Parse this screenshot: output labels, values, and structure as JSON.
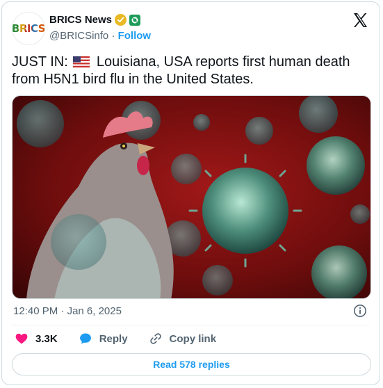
{
  "author": {
    "display_name": "BRICS News",
    "handle": "@BRICSinfo",
    "separator": "·",
    "follow_label": "Follow",
    "avatar_text": "BRICS"
  },
  "tweet": {
    "text_prefix": "JUST IN:",
    "text_body": "Louisiana, USA reports first human death from H5N1 bird flu in the United States."
  },
  "meta": {
    "time": "12:40 PM",
    "separator": "·",
    "date": "Jan 6, 2025"
  },
  "actions": {
    "likes": "3.3K",
    "reply_label": "Reply",
    "copy_label": "Copy link"
  },
  "read_replies_label": "Read 578 replies",
  "icons": [
    "x-logo-icon",
    "verified-gold-icon",
    "org-badge-icon",
    "us-flag-icon",
    "info-icon",
    "heart-icon",
    "reply-bubble-icon",
    "link-icon"
  ],
  "colors": {
    "accent": "#1d9bf0",
    "like": "#f91880",
    "verified": "#e8b923",
    "secondary_text": "#536471",
    "border": "#cfd9de"
  }
}
